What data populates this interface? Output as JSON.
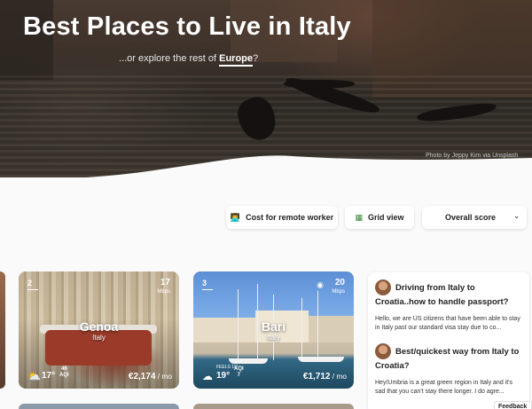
{
  "hero": {
    "title": "Best Places to Live in Italy",
    "subtitle_prefix": "...or explore the rest of ",
    "subtitle_link": "Europe",
    "subtitle_suffix": "?",
    "credit": "Photo by Jeppy Kim via Unsplash"
  },
  "filters": {
    "cost_emoji": "👨‍💻",
    "cost_label": "Cost for remote worker",
    "grid_emoji": "▦",
    "grid_label": "Grid view",
    "sort_label": "Overall score",
    "sort_chevron": "⌄"
  },
  "cards": [
    {
      "rank": "2",
      "internet_speed": "17",
      "internet_unit": "Mbps",
      "city": "Genoa",
      "country": "Italy",
      "weather_icon": "sun-cloud-icon",
      "temperature": "17°",
      "aqi_value": "46",
      "aqi_label": "AQI",
      "price": "€2,174",
      "price_unit": " / mo"
    },
    {
      "rank": "3",
      "internet_speed": "20",
      "internet_unit": "Mbps",
      "city": "Bari",
      "country": "Italy",
      "weather_icon": "rain-cloud-icon",
      "feels_label": "FEELS 19°",
      "temperature": "19°",
      "aqi_value": "7",
      "aqi_label": "AQI",
      "price": "€1,712",
      "price_unit": " / mo"
    }
  ],
  "discussions": [
    {
      "title": "Driving from Italy to Croatia..how to handle passport?",
      "body": "Hello, we are US citizens that have been able to stay in Italy past our standard visa stay due to co..."
    },
    {
      "title": "Best/quickest way from Italy to Croatia?",
      "body": "Hey!Umbria is a great green region in Italy and it's sad that you can't stay there longer. I do agre..."
    }
  ],
  "feedback_label": "Feedback",
  "colors": {
    "page_bg": "#fafafa",
    "card_text": "#ffffff",
    "title_text": "#222222"
  }
}
